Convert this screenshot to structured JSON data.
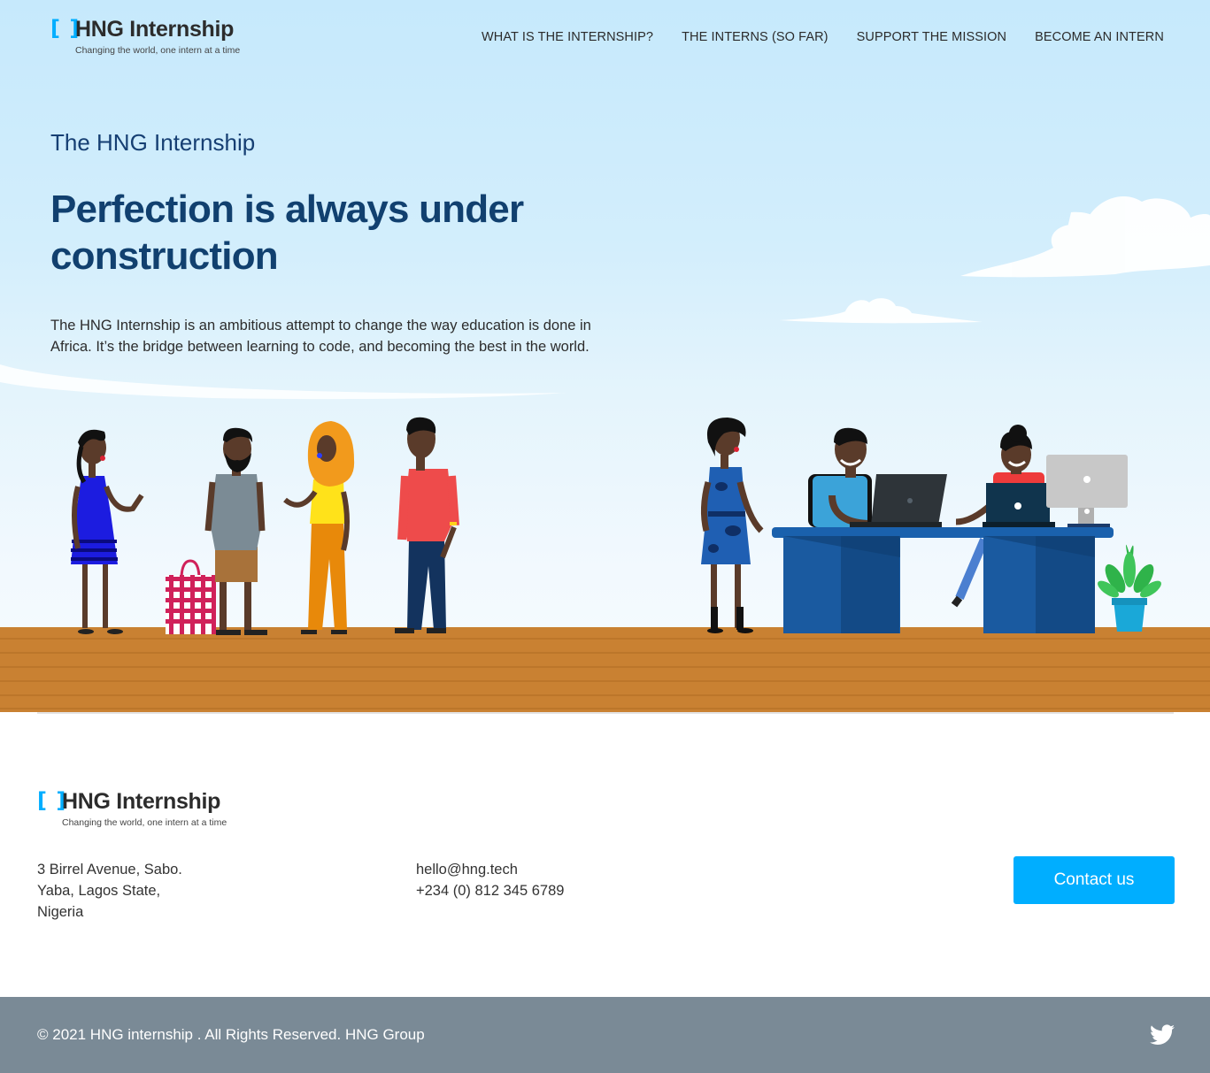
{
  "brand": {
    "name": "HNG Internship",
    "bracket": "[ ]",
    "tagline": "Changing the world, one intern at a time"
  },
  "nav": {
    "items": [
      {
        "label": "WHAT IS THE INTERNSHIP?"
      },
      {
        "label": "THE INTERNS (SO FAR)"
      },
      {
        "label": "SUPPORT THE MISSION"
      },
      {
        "label": "BECOME AN INTERN"
      }
    ]
  },
  "hero": {
    "kicker": "The HNG Internship",
    "title": "Perfection is always under construction",
    "description": "The HNG Internship is an ambitious attempt to change the way education is done in Africa. It’s the bridge between learning to code, and becoming the best in the world."
  },
  "footer": {
    "address_lines": [
      "3 Birrel Avenue, Sabo.",
      "Yaba, Lagos State,",
      "Nigeria"
    ],
    "email": "hello@hng.tech",
    "phone": "+234 (0) 812 345 6789",
    "contact_button": "Contact us",
    "copyright": "© 2021 HNG internship . All Rights Reserved. HNG Group",
    "social_icon": "twitter-icon"
  },
  "colors": {
    "accent": "#00aeff",
    "heading": "#11406f",
    "footer_bar": "#7a8a96",
    "floor": "#c98132"
  }
}
